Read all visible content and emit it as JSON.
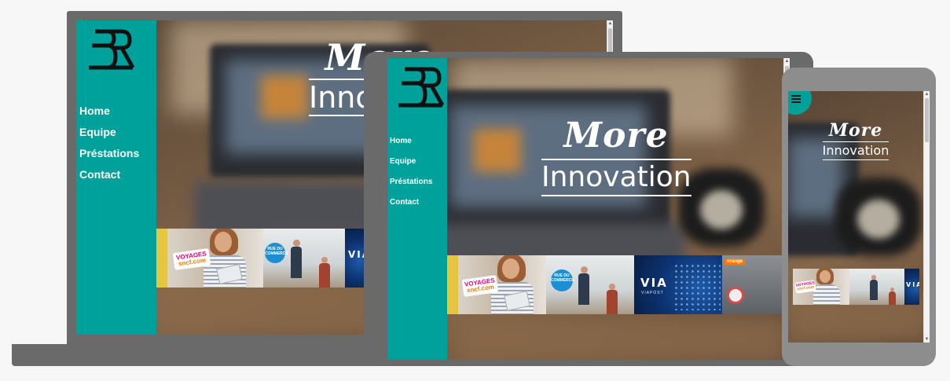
{
  "brand": {
    "logo_icon": "ER-monogram-logo",
    "accent": "#00a19a"
  },
  "nav": {
    "items": [
      {
        "label": "Home"
      },
      {
        "label": "Equipe"
      },
      {
        "label": "Préstations"
      },
      {
        "label": "Contact"
      }
    ]
  },
  "hero": {
    "word1": "More",
    "word2": "Innovation"
  },
  "banner": {
    "sticker_line1": "VOYAGES",
    "sticker_line2": "sncf.com",
    "badge_text": "RUE DU COMMERCE",
    "via_logo": "VIA",
    "via_sub": "VIAPOST",
    "orange_logo": "orange"
  },
  "devices": [
    "laptop",
    "tablet",
    "phone"
  ],
  "menu_icon": "hamburger-menu-icon"
}
